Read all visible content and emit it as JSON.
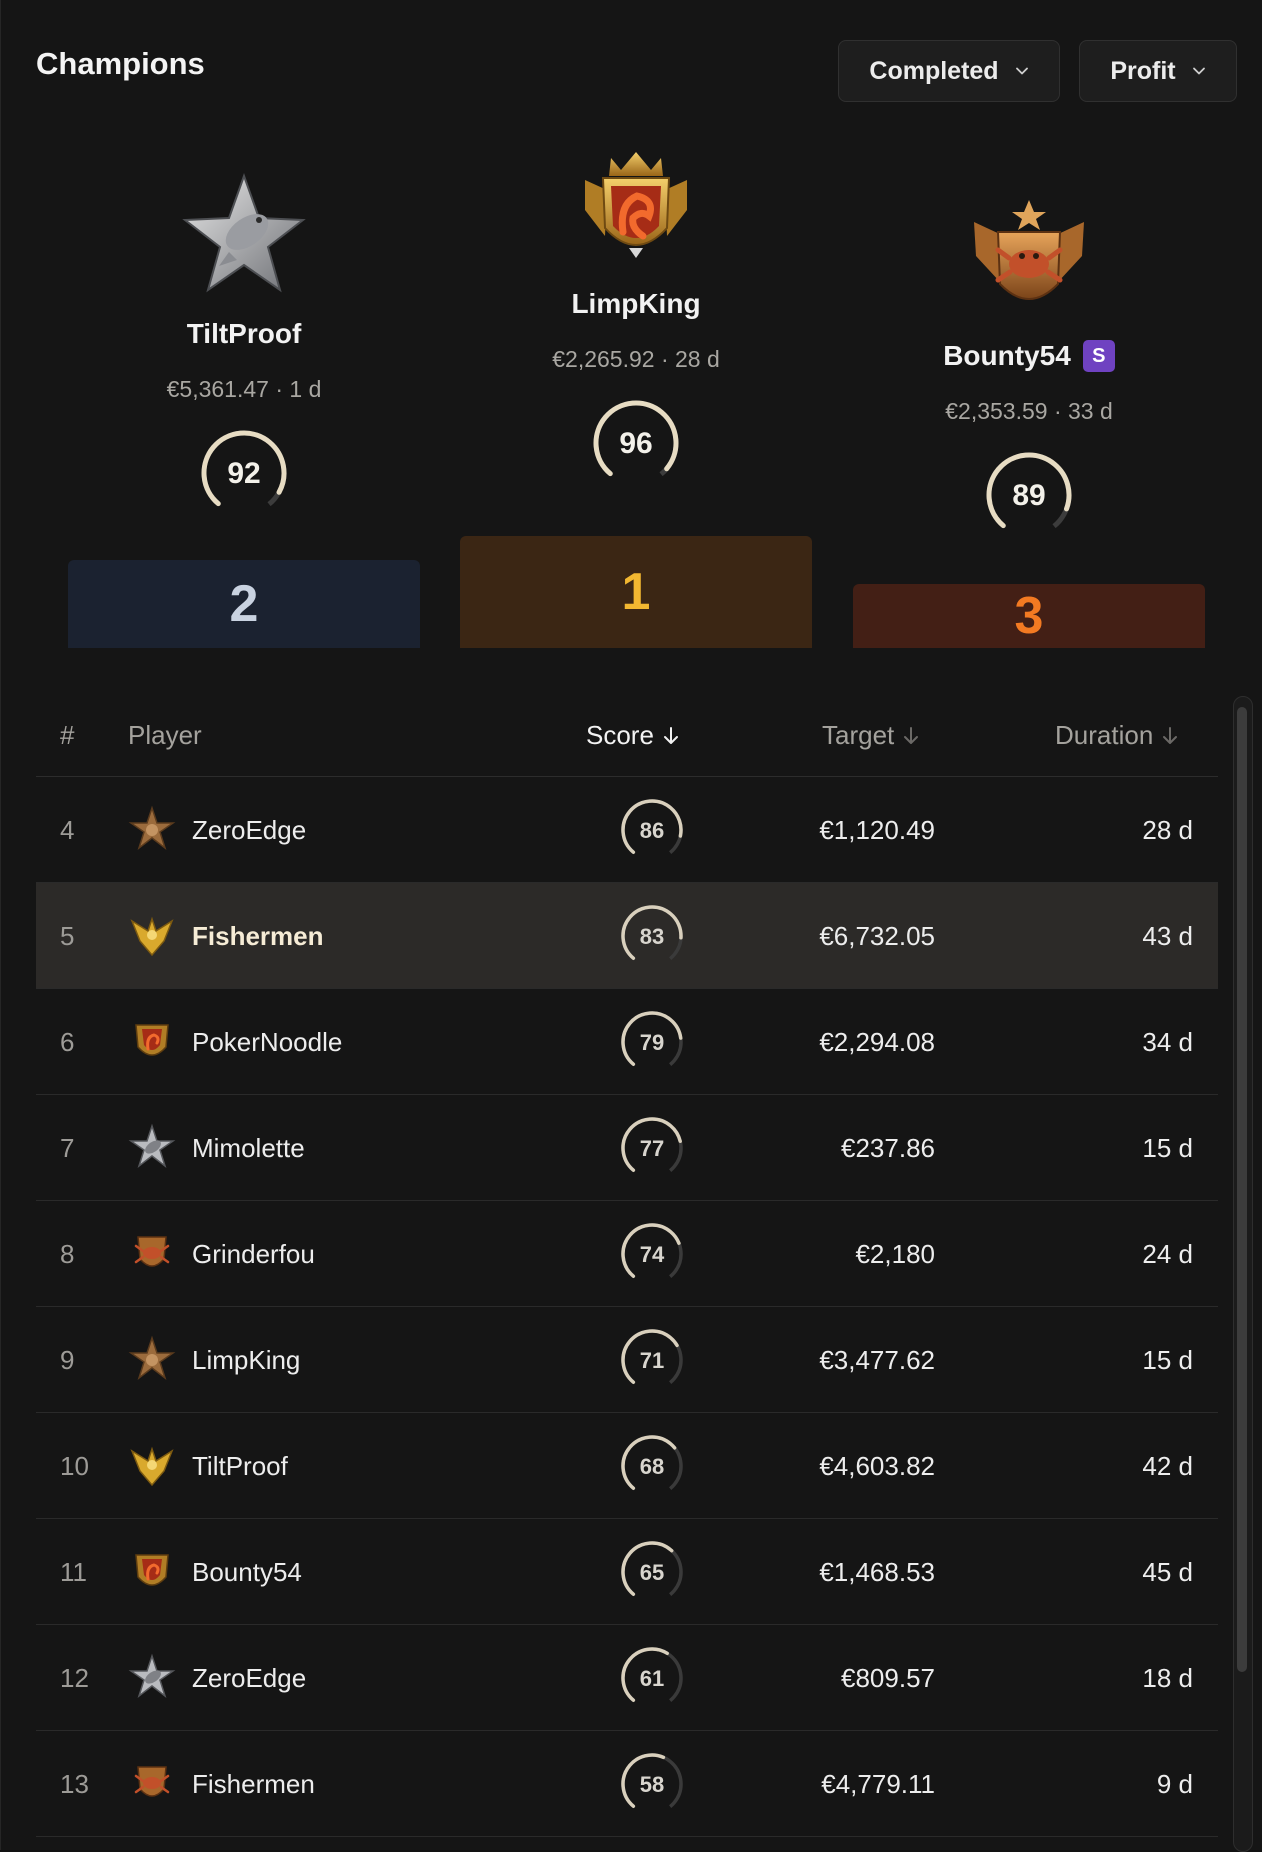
{
  "header": {
    "title": "Champions",
    "status_filter": "Completed",
    "metric_filter": "Profit"
  },
  "podium": [
    {
      "position": "2",
      "name": "TiltProof",
      "amount": "€5,361.47 · 1 d",
      "score": "92",
      "score_value": 92,
      "badge": "silver-star-fish-icon",
      "color": "#1b2230",
      "text_color": "#c9d2e0"
    },
    {
      "position": "1",
      "name": "LimpKing",
      "amount": "€2,265.92 · 28 d",
      "score": "96",
      "score_value": 96,
      "badge": "gold-crown-dragon-shield-icon",
      "color": "#3b2614",
      "text_color": "#f2b731"
    },
    {
      "position": "3",
      "name": "Bounty54",
      "amount": "€2,353.59 · 33 d",
      "score": "89",
      "score_value": 89,
      "badge": "bronze-crab-shield-icon",
      "tag": "S",
      "color": "#431f15",
      "text_color": "#f37a22"
    }
  ],
  "table": {
    "columns": {
      "rank": "#",
      "player": "Player",
      "score": "Score",
      "target": "Target",
      "duration": "Duration"
    },
    "rows": [
      {
        "rank": "4",
        "name": "ZeroEdge",
        "icon": "bronze-star-icon",
        "score": "86",
        "score_value": 86,
        "target": "€1,120.49",
        "duration": "28 d"
      },
      {
        "rank": "5",
        "name": "Fishermen",
        "icon": "gold-eagle-icon",
        "score": "83",
        "score_value": 83,
        "target": "€6,732.05",
        "duration": "43 d",
        "highlighted": true
      },
      {
        "rank": "6",
        "name": "PokerNoodle",
        "icon": "dragon-shield-icon",
        "score": "79",
        "score_value": 79,
        "target": "€2,294.08",
        "duration": "34 d"
      },
      {
        "rank": "7",
        "name": "Mimolette",
        "icon": "silver-star-icon",
        "score": "77",
        "score_value": 77,
        "target": "€237.86",
        "duration": "15 d"
      },
      {
        "rank": "8",
        "name": "Grinderfou",
        "icon": "crab-shield-icon",
        "score": "74",
        "score_value": 74,
        "target": "€2,180",
        "duration": "24 d"
      },
      {
        "rank": "9",
        "name": "LimpKing",
        "icon": "bronze-star-icon",
        "score": "71",
        "score_value": 71,
        "target": "€3,477.62",
        "duration": "15 d"
      },
      {
        "rank": "10",
        "name": "TiltProof",
        "icon": "gold-eagle-icon",
        "score": "68",
        "score_value": 68,
        "target": "€4,603.82",
        "duration": "42 d"
      },
      {
        "rank": "11",
        "name": "Bounty54",
        "icon": "dragon-shield-icon",
        "score": "65",
        "score_value": 65,
        "target": "€1,468.53",
        "duration": "45 d"
      },
      {
        "rank": "12",
        "name": "ZeroEdge",
        "icon": "silver-star-icon",
        "score": "61",
        "score_value": 61,
        "target": "€809.57",
        "duration": "18 d"
      },
      {
        "rank": "13",
        "name": "Fishermen",
        "icon": "crab-shield-icon",
        "score": "58",
        "score_value": 58,
        "target": "€4,779.11",
        "duration": "9 d"
      }
    ]
  }
}
